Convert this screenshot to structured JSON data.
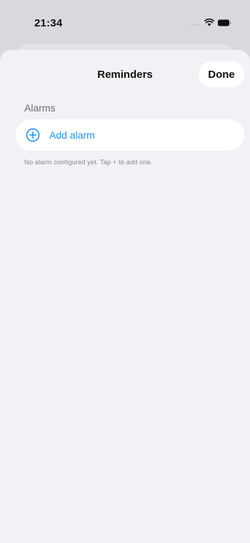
{
  "status_bar": {
    "time": "21:34",
    "signal": "....",
    "icons": [
      "wifi-icon",
      "battery-icon"
    ]
  },
  "nav": {
    "title": "Reminders",
    "done_label": "Done"
  },
  "alarms": {
    "section_title": "Alarms",
    "add_label": "Add alarm",
    "add_icon": "plus-circle-icon",
    "empty_hint": "No alarm configured yet. Tap + to add one."
  },
  "colors": {
    "accent": "#1f8ff0",
    "sheet_background": "#f2f2f6",
    "row_background": "#ffffff"
  }
}
